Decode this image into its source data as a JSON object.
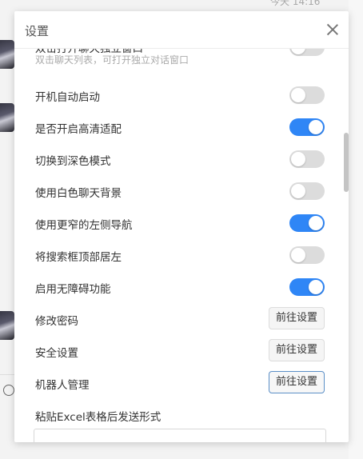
{
  "background": {
    "timestamp": "今天 14:16"
  },
  "dialog": {
    "title": "设置"
  },
  "settings": {
    "partial_row": {
      "label": "双击打开聊天独立窗口",
      "description": "双击聊天列表，可打开独立对话窗口",
      "enabled": false
    },
    "toggles": [
      {
        "label": "开机自动启动",
        "enabled": false
      },
      {
        "label": "是否开启高清适配",
        "enabled": true
      },
      {
        "label": "切换到深色模式",
        "enabled": false
      },
      {
        "label": "使用白色聊天背景",
        "enabled": false
      },
      {
        "label": "使用更窄的左侧导航",
        "enabled": true
      },
      {
        "label": "将搜索框顶部居左",
        "enabled": false
      },
      {
        "label": "启用无障碍功能",
        "enabled": true
      }
    ],
    "links": [
      {
        "label": "修改密码",
        "button": "前往设置"
      },
      {
        "label": "安全设置",
        "button": "前往设置"
      },
      {
        "label": "机器人管理",
        "button": "前往设置"
      }
    ],
    "paste_excel": {
      "label": "粘贴Excel表格后发送形式"
    }
  },
  "colors": {
    "accent": "#2f86f6",
    "toggle_off": "#dcdcdc"
  }
}
